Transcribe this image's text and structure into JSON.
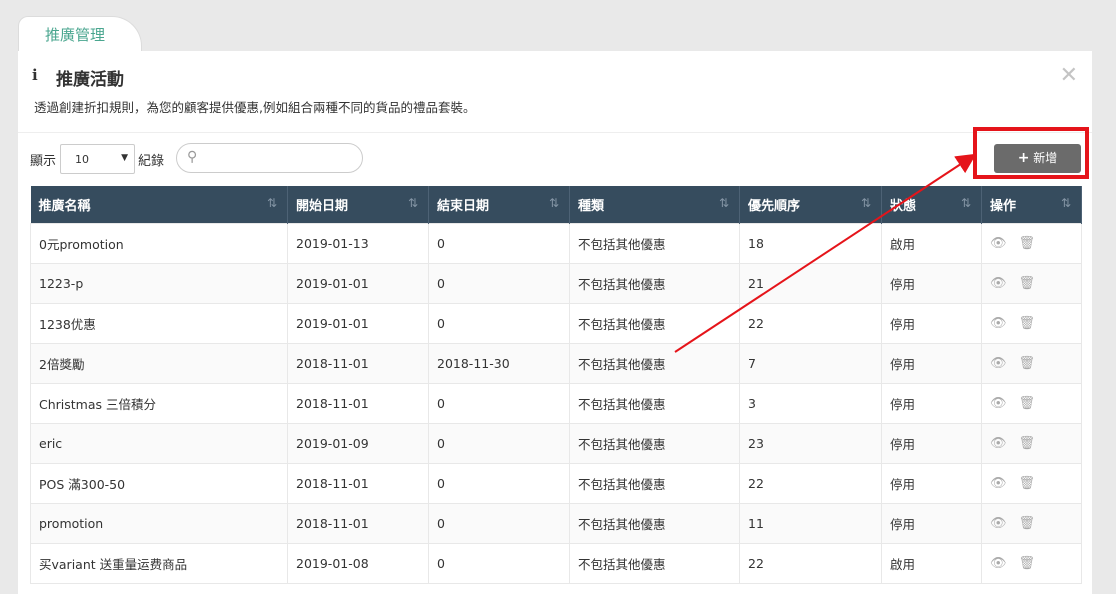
{
  "tab": {
    "label": "推廣管理"
  },
  "panel": {
    "title": "推廣活動",
    "description": "透過創建折扣規則，為您的顧客提供優惠,例如組合兩種不同的貨品的禮品套裝。"
  },
  "controls": {
    "show_label": "顯示",
    "page_size": "10",
    "records_label": "紀錄",
    "search_placeholder": "",
    "add_button": "新增"
  },
  "table": {
    "columns": [
      "推廣名稱",
      "開始日期",
      "結束日期",
      "種類",
      "優先順序",
      "狀態",
      "操作"
    ],
    "rows": [
      [
        "0元promotion",
        "2019-01-13",
        "0",
        "不包括其他優惠",
        "18",
        "啟用"
      ],
      [
        "1223-p",
        "2019-01-01",
        "0",
        "不包括其他優惠",
        "21",
        "停用"
      ],
      [
        "1238优惠",
        "2019-01-01",
        "0",
        "不包括其他優惠",
        "22",
        "停用"
      ],
      [
        "2倍獎勵",
        "2018-11-01",
        "2018-11-30",
        "不包括其他優惠",
        "7",
        "停用"
      ],
      [
        "Christmas 三倍積分",
        "2018-11-01",
        "0",
        "不包括其他優惠",
        "3",
        "停用"
      ],
      [
        "eric",
        "2019-01-09",
        "0",
        "不包括其他優惠",
        "23",
        "停用"
      ],
      [
        "POS 滿300-50",
        "2018-11-01",
        "0",
        "不包括其他優惠",
        "22",
        "停用"
      ],
      [
        "promotion",
        "2018-11-01",
        "0",
        "不包括其他優惠",
        "11",
        "停用"
      ],
      [
        "买variant 送重量运费商品",
        "2019-01-08",
        "0",
        "不包括其他優惠",
        "22",
        "啟用"
      ]
    ]
  },
  "colors": {
    "header_bg": "#364c5e",
    "accent_tab": "#4aa68f",
    "annotation": "#e5141a"
  },
  "icons": [
    "info-icon",
    "close-icon",
    "search-icon",
    "plus-icon",
    "sort-icon",
    "eye-icon",
    "trash-icon",
    "caret-down-icon"
  ]
}
